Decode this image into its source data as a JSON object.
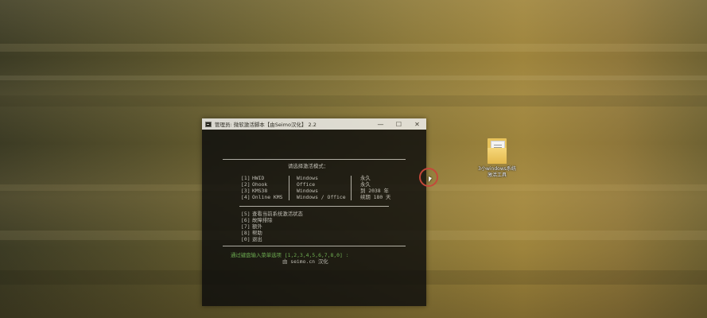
{
  "console": {
    "title": "管理员:  微软激活脚本【由Seimo汉化】 2.2",
    "controls": {
      "minimize": "—",
      "maximize": "☐",
      "close": "✕"
    },
    "prompt": "请选择激活模式：",
    "activation_options": [
      {
        "key": "[1]",
        "name": "HWID",
        "target": "Windows",
        "duration": "永久"
      },
      {
        "key": "[2]",
        "name": "Ohook",
        "target": "Office",
        "duration": "永久"
      },
      {
        "key": "[3]",
        "name": "KMS38",
        "target": "Windows",
        "duration": "到 2038 年"
      },
      {
        "key": "[4]",
        "name": "Online KMS",
        "target": "Windows / Office",
        "duration": "续期 180 天"
      }
    ],
    "tool_options": [
      {
        "key": "[5]",
        "label": "查看当前系统激活状态"
      },
      {
        "key": "[6]",
        "label": "故障排除"
      },
      {
        "key": "[7]",
        "label": "额外"
      },
      {
        "key": "[8]",
        "label": "帮助"
      },
      {
        "key": "[0]",
        "label": "退出"
      }
    ],
    "input_prompt": "通过键盘输入菜单选项 [1,2,3,4,5,6,7,8,0] :",
    "credit": "由 seimo.cn 汉化"
  },
  "desktop_icon": {
    "icon": "folder-document-icon",
    "label_line1": "3小windows系统",
    "label_line2": "激活工具"
  },
  "colors": {
    "console_bg": "#0c0c0c",
    "console_text": "#cfcfcf",
    "prompt_green": "#6fbf5a",
    "cursor_ring": "#c4483a"
  }
}
